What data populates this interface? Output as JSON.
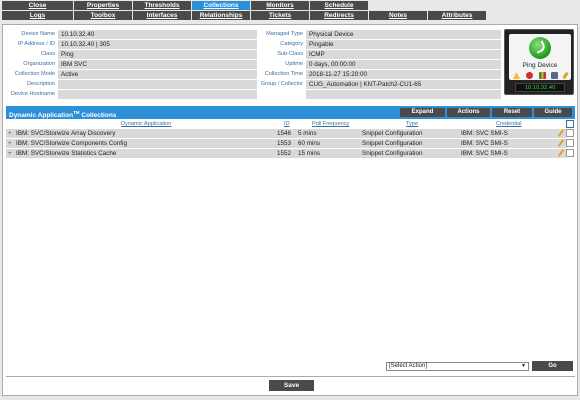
{
  "tabs_row1": [
    {
      "label": "Close",
      "active": false
    },
    {
      "label": "Properties",
      "active": false
    },
    {
      "label": "Thresholds",
      "active": false
    },
    {
      "label": "Collections",
      "active": true
    },
    {
      "label": "Monitors",
      "active": false
    },
    {
      "label": "Schedule",
      "active": false
    }
  ],
  "tabs_row2": [
    {
      "label": "Logs"
    },
    {
      "label": "Toolbox"
    },
    {
      "label": "Interfaces"
    },
    {
      "label": "Relationships"
    },
    {
      "label": "Tickets"
    },
    {
      "label": "Redirects"
    },
    {
      "label": "Notes"
    },
    {
      "label": "Attributes"
    }
  ],
  "info_left": [
    {
      "label": "Device Name",
      "value": "10.10.32.40"
    },
    {
      "label": "IP Address / ID",
      "value": "10.10.32.40 | 305"
    },
    {
      "label": "Class",
      "value": "Ping"
    },
    {
      "label": "Organization",
      "value": "IBM SVC"
    },
    {
      "label": "Collection Mode",
      "value": "Active"
    },
    {
      "label": "Description",
      "value": ""
    },
    {
      "label": "Device Hostname",
      "value": ""
    }
  ],
  "info_right": [
    {
      "label": "Managed Type",
      "value": "Physical Device"
    },
    {
      "label": "Category",
      "value": "Pingable"
    },
    {
      "label": "Sub-Class",
      "value": "ICMP"
    },
    {
      "label": "Uptime",
      "value": "0 days, 00:00:00"
    },
    {
      "label": "Collection Time",
      "value": "2018-11-27 15:20:00"
    },
    {
      "label": "Group / Collector",
      "value": "CUG_Automation | KNT-Patch2-CU1-65"
    }
  ],
  "device_box": {
    "label": "Ping Device",
    "ip": "10.10.32.40"
  },
  "collections": {
    "title": "Dynamic Application",
    "title_sup": "TM",
    "title_suffix": " Collections",
    "buttons": [
      "Expand",
      "Actions",
      "Reset",
      "Guide"
    ],
    "columns": [
      "Dynamic Application",
      "ID",
      "Poll Frequency",
      "Type",
      "Credential"
    ],
    "rows": [
      {
        "app": "IBM: SVC/Storwize Array Discovery",
        "id": "1546",
        "freq": "5 mins",
        "type": "Snippet Configuration",
        "cred": "IBM: SVC SMI-S"
      },
      {
        "app": "IBM: SVC/Storwize Components Config",
        "id": "1553",
        "freq": "60 mins",
        "type": "Snippet Configuration",
        "cred": "IBM: SVC SMI-S"
      },
      {
        "app": "IBM: SVC/Storwize Statistics Cache",
        "id": "1552",
        "freq": "15 mins",
        "type": "Snippet Configuration",
        "cred": "IBM: SVC SMI-S"
      }
    ]
  },
  "select_action": "[Select Action]",
  "go_label": "Go",
  "save_label": "Save"
}
